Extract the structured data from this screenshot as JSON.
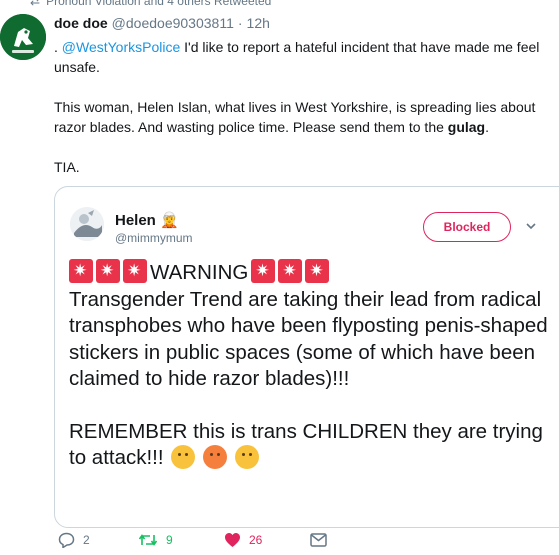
{
  "retweet_context": "Pronoun Violation and 4 others Retweeted",
  "tweet": {
    "name": "doe doe",
    "handle": "@doedoe90303811",
    "separator": "·",
    "time": "12h",
    "para1_prefix": ".",
    "mention": "@WestYorksPolice",
    "para1_rest": "I'd like to report a hateful incident that have made me feel unsafe.",
    "para2_text": "This woman, Helen Islan, what lives in West Yorkshire, is spreading lies about razor blades. And wasting police time. Please send them to the",
    "para2_bold": "gulag",
    "para2_end": ".",
    "para3": "TIA."
  },
  "quoted": {
    "name": "Helen",
    "handle": "@mimmymum",
    "blocked_label": "Blocked",
    "warning": "WARNING",
    "body1": "Transgender Trend are taking their lead from radical transphobes who have been flyposting penis-shaped stickers in public spaces (some of which have been claimed to hide razor blades)!!!",
    "body2": "REMEMBER this is trans CHILDREN they are trying to attack!!!"
  },
  "actions": {
    "reply_count": "2",
    "retweet_count": "9",
    "like_count": "26"
  },
  "colors": {
    "link": "#1b95e0",
    "blocked": "#e0245e",
    "retweet": "#17bf63",
    "like": "#e0245e",
    "muted": "#657786"
  }
}
